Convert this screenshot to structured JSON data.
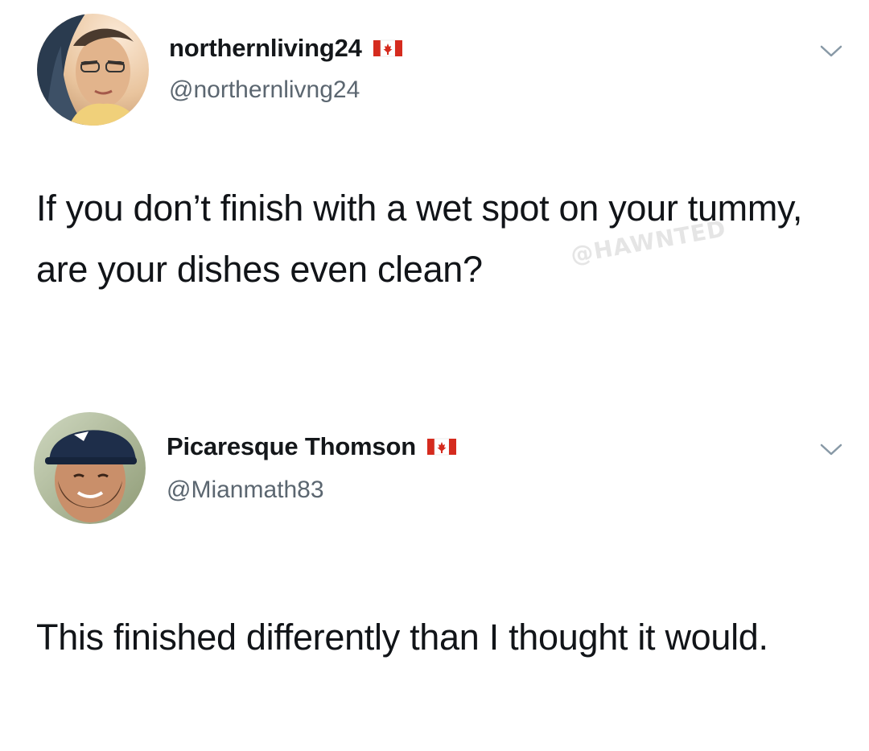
{
  "tweets": [
    {
      "display_name": "northernliving24",
      "handle": "@northernlivng24",
      "flag_icon": "canada-flag-icon",
      "menu_icon": "chevron-down-icon",
      "text": "If you don’t finish with a wet spot on your tummy, are your dishes even clean?"
    },
    {
      "display_name": "Picaresque Thomson",
      "handle": "@Mianmath83",
      "flag_icon": "canada-flag-icon",
      "menu_icon": "chevron-down-icon",
      "text": "This finished differently than I thought it would."
    }
  ],
  "watermark": "@HAWNTED",
  "colors": {
    "name": "#14171a",
    "handle": "#5b6670",
    "text": "#111418",
    "flag_red": "#d52b1e",
    "chevron": "#8899a6"
  }
}
